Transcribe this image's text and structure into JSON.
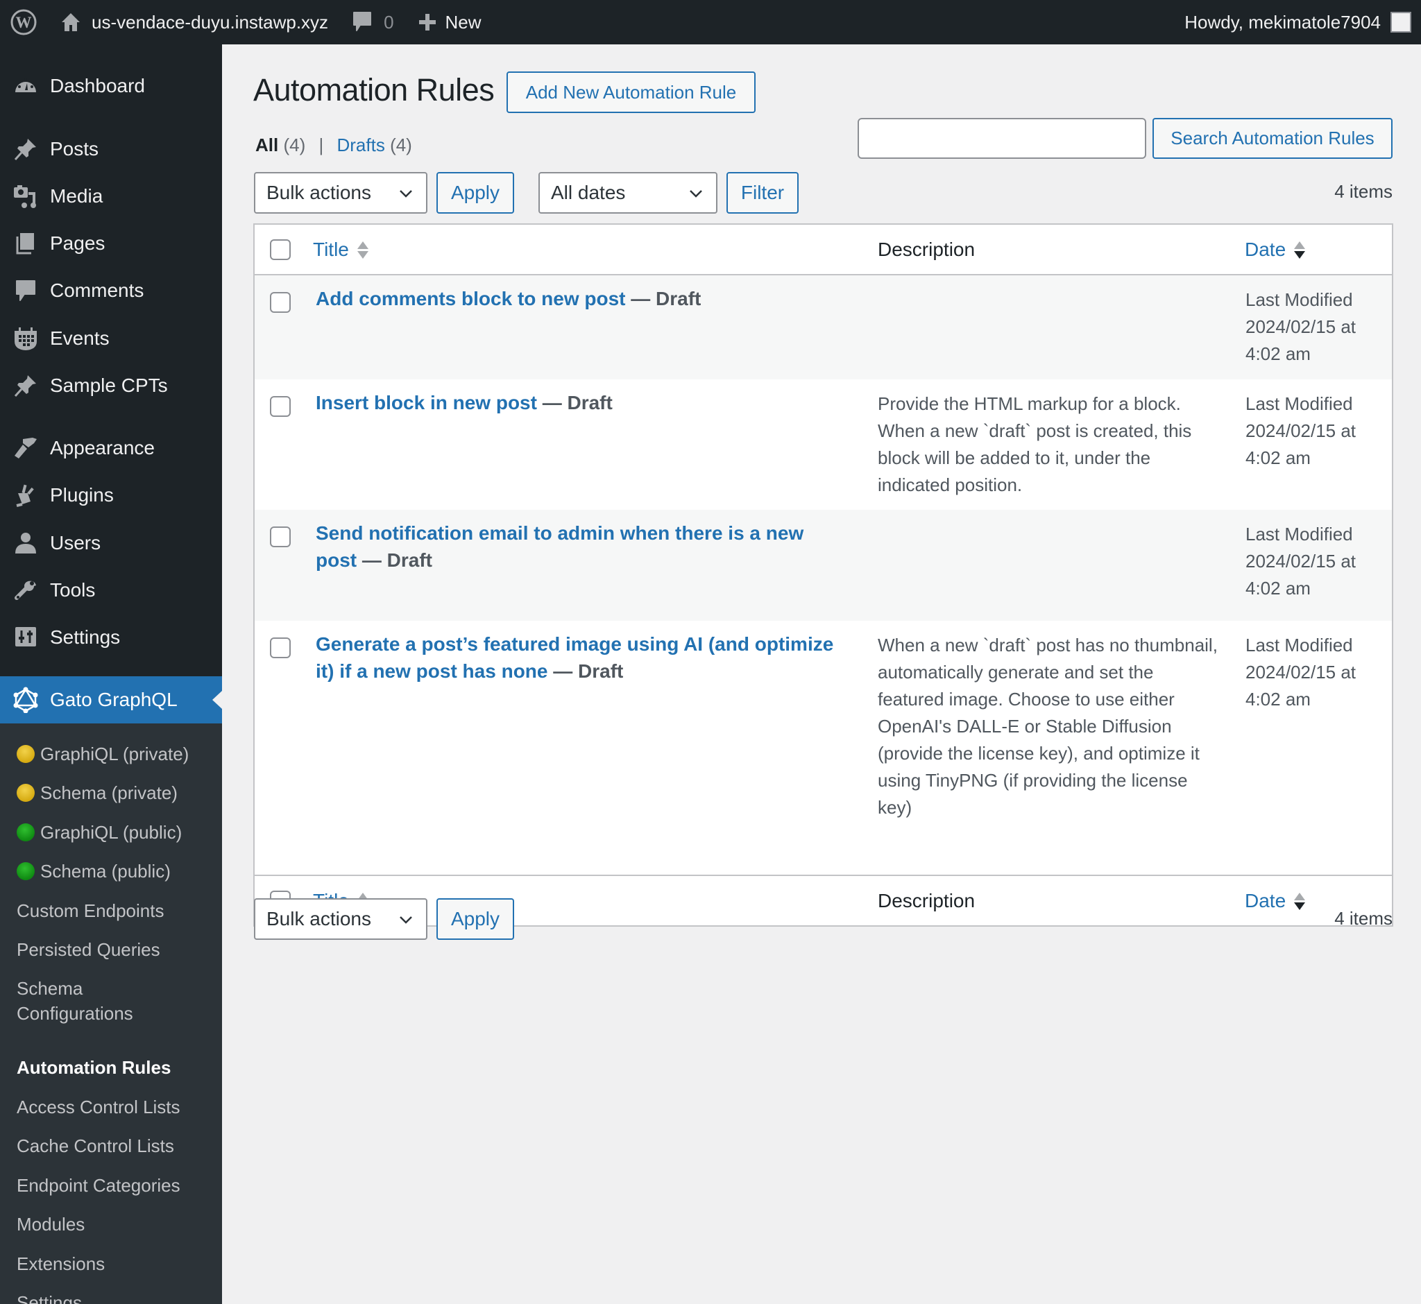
{
  "admin_bar": {
    "site_name": "us-vendace-duyu.instawp.xyz",
    "comments_count": "0",
    "new_label": "New",
    "howdy": "Howdy, mekimatole7904"
  },
  "sidebar": {
    "items": [
      {
        "label": "Dashboard",
        "icon": "dashboard-icon"
      },
      {
        "label": "Posts",
        "icon": "pin-icon"
      },
      {
        "label": "Media",
        "icon": "media-icon"
      },
      {
        "label": "Pages",
        "icon": "pages-icon"
      },
      {
        "label": "Comments",
        "icon": "comment-icon"
      },
      {
        "label": "Events",
        "icon": "calendar-icon"
      },
      {
        "label": "Sample CPTs",
        "icon": "pin-icon"
      },
      {
        "label": "Appearance",
        "icon": "brush-icon"
      },
      {
        "label": "Plugins",
        "icon": "plug-icon"
      },
      {
        "label": "Users",
        "icon": "user-icon"
      },
      {
        "label": "Tools",
        "icon": "wrench-icon"
      },
      {
        "label": "Settings",
        "icon": "sliders-icon"
      },
      {
        "label": "Gato GraphQL",
        "icon": "graphql-icon",
        "current": true
      }
    ],
    "submenu": [
      {
        "label": "GraphiQL (private)",
        "dot": "yellow"
      },
      {
        "label": "Schema (private)",
        "dot": "yellow"
      },
      {
        "label": "GraphiQL (public)",
        "dot": "green"
      },
      {
        "label": "Schema (public)",
        "dot": "green"
      },
      {
        "label": "Custom Endpoints"
      },
      {
        "label": "Persisted Queries"
      },
      {
        "label": "Schema Configurations"
      },
      {
        "label": "Automation Rules",
        "current": true
      },
      {
        "label": "Access Control Lists"
      },
      {
        "label": "Cache Control Lists"
      },
      {
        "label": "Endpoint Categories"
      },
      {
        "label": "Modules"
      },
      {
        "label": "Extensions"
      },
      {
        "label": "Settings"
      }
    ]
  },
  "page": {
    "title": "Automation Rules",
    "add_new_label": "Add New Automation Rule",
    "views": {
      "all_label": "All",
      "all_count": "(4)",
      "separator": "|",
      "drafts_label": "Drafts",
      "drafts_count": "(4)"
    },
    "search": {
      "value": "",
      "button_label": "Search Automation Rules"
    },
    "bulk_actions_selected": "Bulk actions",
    "apply_label": "Apply",
    "dates_selected": "All dates",
    "filter_label": "Filter",
    "items_count": "4 items"
  },
  "table": {
    "columns": {
      "title": "Title",
      "description": "Description",
      "date": "Date"
    },
    "rows": [
      {
        "title": "Add comments block to new post",
        "state": " — Draft",
        "description": "",
        "date_label": "Last Modified",
        "date": "2024/02/15 at 4:02 am"
      },
      {
        "title": "Insert block in new post",
        "state": " — Draft",
        "description": "Provide the HTML markup for a block. When a new `draft` post is created, this block will be added to it, under the indicated position.",
        "date_label": "Last Modified",
        "date": "2024/02/15 at 4:02 am"
      },
      {
        "title": "Send notification email to admin when there is a new post",
        "state": " — Draft",
        "description": "",
        "date_label": "Last Modified",
        "date": "2024/02/15 at 4:02 am"
      },
      {
        "title": "Generate a post’s featured image using AI (and optimize it) if a new post has none",
        "state": " — Draft",
        "description": "When a new `draft` post has no thumbnail, automatically generate and set the featured image. Choose to use either OpenAI's DALL-E or Stable Diffusion (provide the license key), and optimize it using TinyPNG (if providing the license key)",
        "date_label": "Last Modified",
        "date": "2024/02/15 at 4:02 am"
      }
    ]
  },
  "colors": {
    "accent": "#2271b1",
    "admin_bar_bg": "#1d2327",
    "submenu_bg": "#2c3338",
    "page_bg": "#f0f0f1"
  }
}
